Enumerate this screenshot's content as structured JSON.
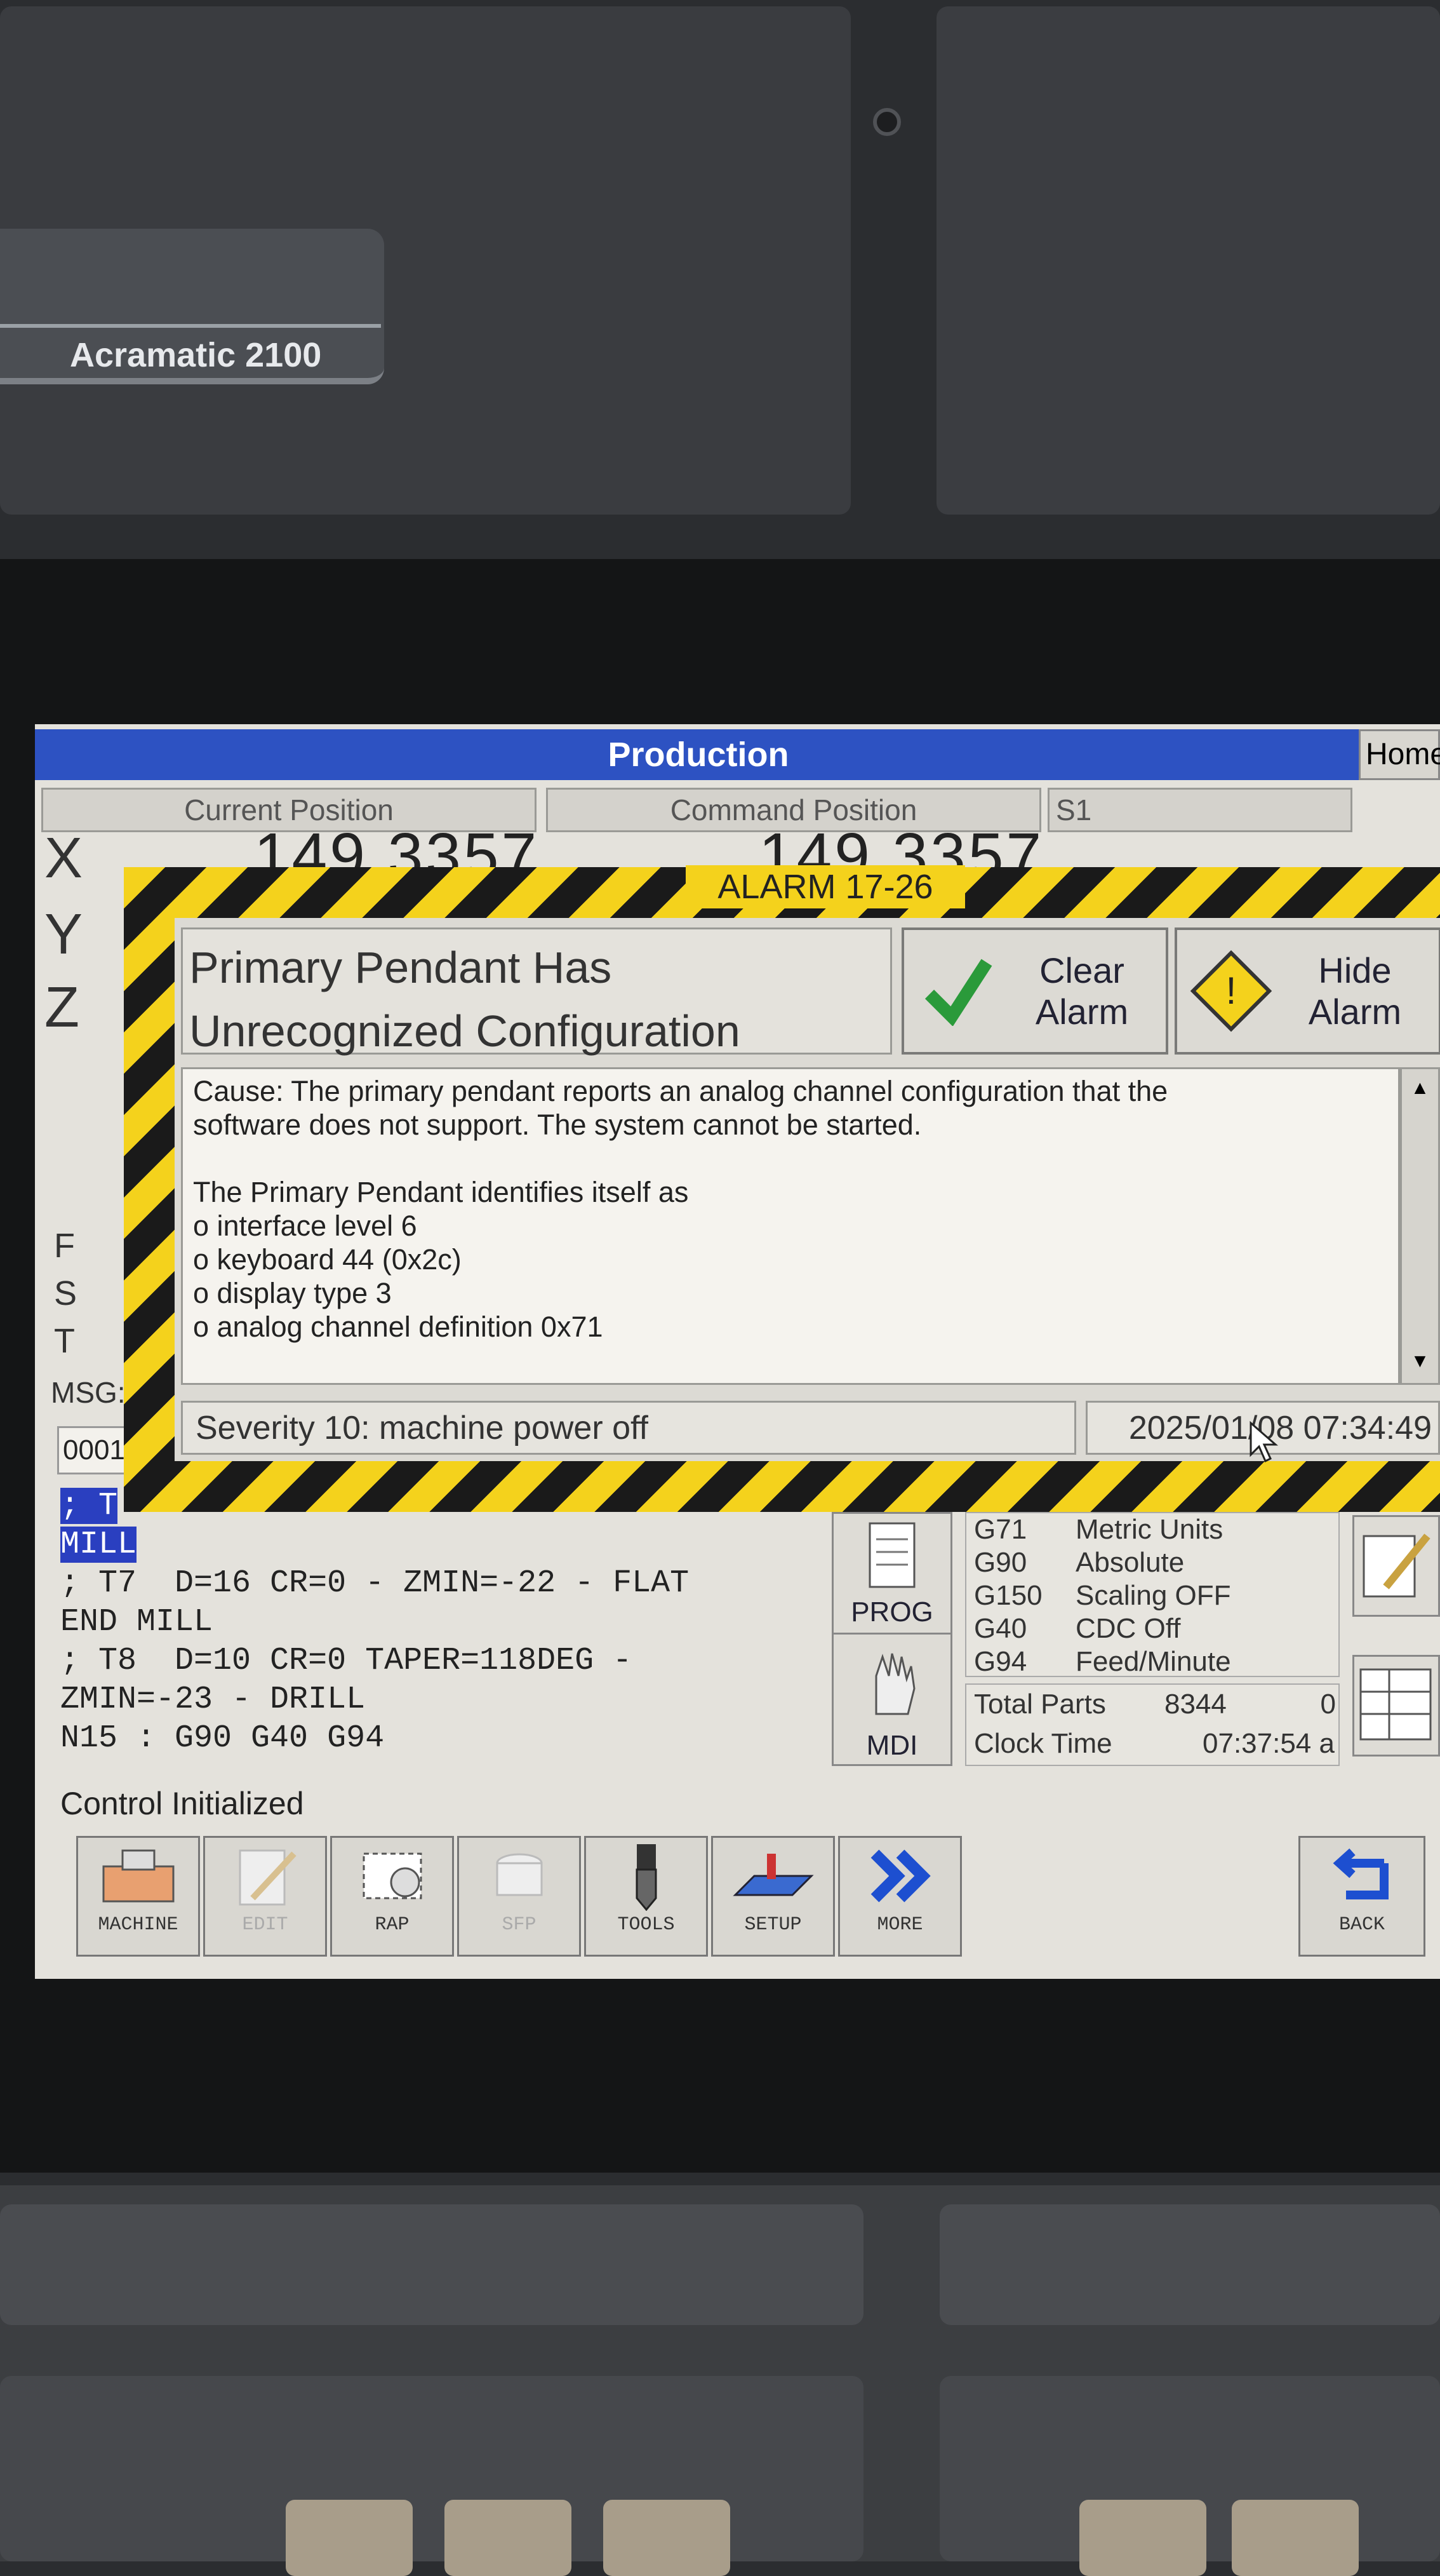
{
  "brand": "Acramatic 2100",
  "window": {
    "title": "Production",
    "home_tab": "Home"
  },
  "position": {
    "current_label": "Current Position",
    "command_label": "Command Position",
    "x_current": "149.3357",
    "x_command": "149.3357",
    "spindle_label": "S1",
    "axes": [
      "X",
      "Y",
      "Z"
    ],
    "side_letters": [
      "F",
      "S",
      "T"
    ]
  },
  "msg_label": "MSG:",
  "line_number": "0001",
  "alarm": {
    "tag": "ALARM 17-26",
    "title_line1": "Primary Pendant Has",
    "title_line2": "Unrecognized Configuration",
    "clear_button": {
      "line1": "Clear",
      "line2": "Alarm"
    },
    "hide_button": {
      "line1": "Hide",
      "line2": "Alarm"
    },
    "body": [
      "Cause: The primary pendant reports an analog channel configuration that the",
      "software does not support.  The system cannot be started.",
      "",
      "The Primary Pendant identifies itself as",
      "o interface level 6",
      "o keyboard 44 (0x2c)",
      "o display type 3",
      "o analog channel definition 0x71"
    ],
    "severity": "Severity 10: machine power off",
    "timestamp": "2025/01/08 07:34:49"
  },
  "program": {
    "highlighted": [
      "; T",
      "MILL"
    ],
    "lines": [
      "; T7  D=16 CR=0 - ZMIN=-22 - FLAT",
      "END MILL",
      "; T8  D=10 CR=0 TAPER=118DEG -",
      "ZMIN=-23 - DRILL",
      "N15 : G90 G40 G94"
    ]
  },
  "side_buttons": {
    "prog": "PROG",
    "mdi": "MDI"
  },
  "modal_codes": [
    {
      "code": "G71",
      "desc": "Metric Units"
    },
    {
      "code": "G90",
      "desc": "Absolute"
    },
    {
      "code": "G150",
      "desc": "Scaling OFF"
    },
    {
      "code": "G40",
      "desc": "CDC Off"
    },
    {
      "code": "G94",
      "desc": "Feed/Minute"
    }
  ],
  "counters": {
    "total_parts_label": "Total Parts",
    "total_parts_value": "8344",
    "total_parts_extra": "0",
    "clock_label": "Clock Time",
    "clock_value": "07:37:54 a"
  },
  "status": "Control Initialized",
  "toolbar": {
    "machine": "MACHINE",
    "edit": "EDIT",
    "rap": "RAP",
    "sfp": "SFP",
    "tools": "TOOLS",
    "setup": "SETUP",
    "more": "MORE",
    "back": "BACK"
  },
  "colors": {
    "title_bar": "#2d52c2",
    "alarm_yellow": "#f4d21c",
    "highlight": "#2a3fc0"
  }
}
